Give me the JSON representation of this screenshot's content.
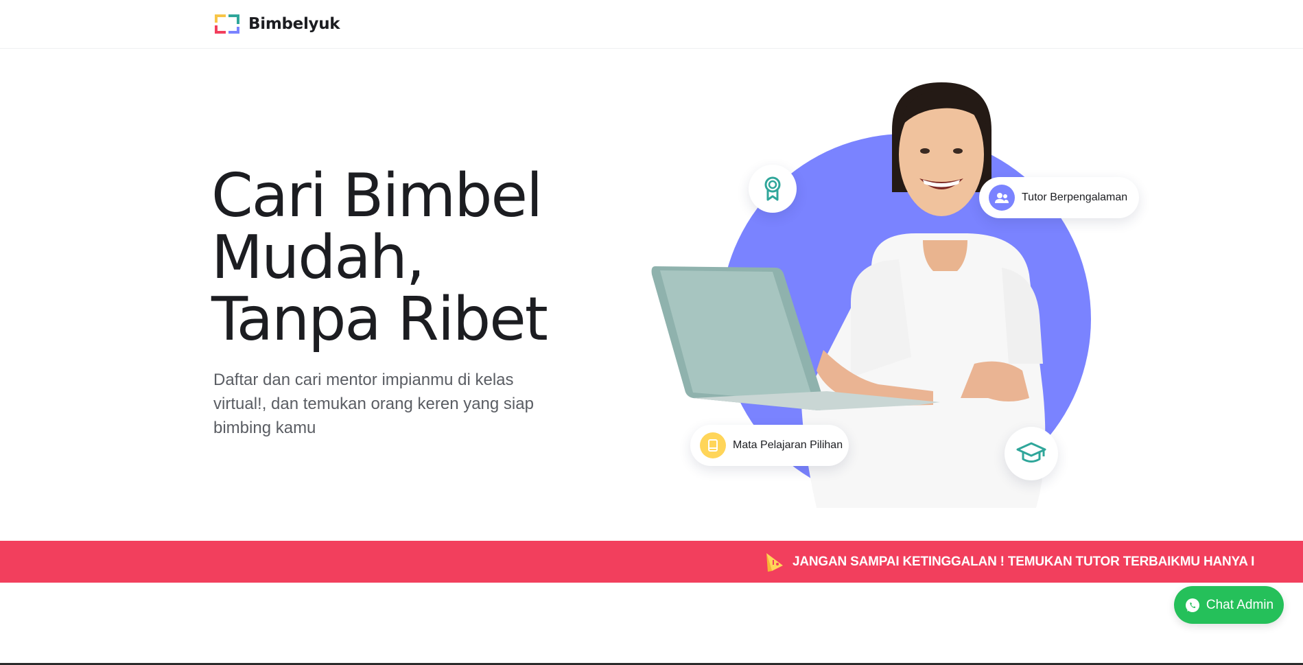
{
  "navbar": {
    "brand": "Bimbelyuk",
    "logo_icon": "bimbelyuk-logo-icon"
  },
  "hero": {
    "title_lines": [
      "Cari Bimbel",
      "Mudah,",
      "Tanpa Ribet"
    ],
    "subtitle_lines": [
      "Daftar dan cari mentor impianmu di kelas",
      "virtual!, dan temukan orang keren yang siap",
      "bimbing kamu"
    ]
  },
  "badges": {
    "tutor": {
      "label": "Tutor Berpengalaman",
      "icon": "users-icon"
    },
    "mapel": {
      "label": "Mata Pelajaran Pilihan",
      "icon": "book-icon"
    },
    "award_icon": "award-ribbon-icon",
    "grad_icon": "graduation-cap-icon"
  },
  "marquee": {
    "text": "JANGAN SAMPAI KETINGGALAN ! TEMUKAN TUTOR TERBAIKMU HANYA I",
    "icon": "megaphone-icon"
  },
  "chat": {
    "label": "Chat Admin",
    "icon": "whatsapp-icon"
  },
  "colors": {
    "accent_blue": "#7a83ff",
    "marquee_red": "#f23f5d",
    "chat_green": "#25c05a",
    "teal_icon": "#2fa69a",
    "yellow": "#ffd559"
  }
}
